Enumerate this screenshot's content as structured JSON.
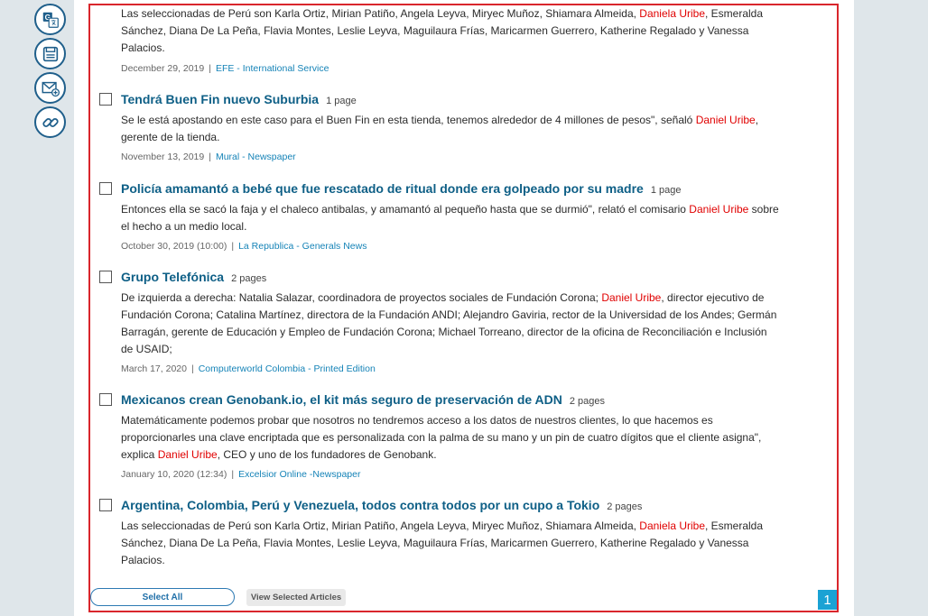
{
  "toolbar": {
    "buttons": [
      {
        "name": "translate-icon"
      },
      {
        "name": "save-icon"
      },
      {
        "name": "email-icon"
      },
      {
        "name": "link-icon"
      }
    ]
  },
  "partial_article": {
    "snippet_before": "Las seleccionadas de Perú son Karla Ortiz, Mirian Patiño, Angela Leyva, Miryec Muñoz, Shiamara Almeida, ",
    "highlight": "Daniela Uribe",
    "snippet_after": ", Esmeralda Sánchez, Diana De La Peña, Flavia Montes, Leslie Leyva, Maguilaura Frías, Maricarmen Guerrero, Katherine Regalado y Vanessa Palacios.",
    "date": "December 29, 2019",
    "separator": "|",
    "source": "EFE - International Service"
  },
  "articles": [
    {
      "title": "Tendrá Buen Fin nuevo Suburbia",
      "pages": "1 page",
      "snippet_before": "Se le está apostando en este caso para el Buen Fin en esta tienda, tenemos alrededor de 4 millones de pesos\", señaló ",
      "highlight": "Daniel Uribe",
      "snippet_after": ", gerente de la tienda.",
      "date": "November 13, 2019",
      "separator": "|",
      "source": "Mural - Newspaper"
    },
    {
      "title": "Policía amamantó a bebé que fue rescatado de ritual donde era golpeado por su madre",
      "pages": "1 page",
      "snippet_before": "Entonces ella se sacó la faja y el chaleco antibalas, y amamantó al pequeño hasta que se durmió\", relató el comisario ",
      "highlight": "Daniel Uribe",
      "snippet_after": " sobre el hecho a un medio local.",
      "date": "October 30, 2019 (10:00)",
      "separator": "|",
      "source": "La Republica - Generals News"
    },
    {
      "title": "Grupo Telefónica",
      "pages": "2 pages",
      "snippet_before": "De izquierda a derecha: Natalia Salazar, coordinadora de proyectos sociales de Fundación Corona; ",
      "highlight": "Daniel Uribe",
      "snippet_after": ", director ejecutivo de Fundación Corona; Catalina Martínez, directora de la Fundación ANDI; Alejandro Gaviria, rector de la Universidad de los Andes; Germán Barragán, gerente de Educación y Empleo de Fundación Corona; Michael Torreano, director de la oficina de Reconciliación e Inclusión de USAID;",
      "date": "March 17, 2020",
      "separator": "|",
      "source": "Computerworld Colombia - Printed Edition"
    },
    {
      "title": "Mexicanos crean Genobank.io, el kit más seguro de preservación de ADN",
      "pages": "2 pages",
      "snippet_before": "Matemáticamente podemos probar que nosotros no tendremos acceso a los datos de nuestros clientes, lo que hacemos es proporcionarles una clave encriptada que es personalizada con la palma de su mano y un pin de cuatro dígitos que el cliente asigna\", explica ",
      "highlight": "Daniel Uribe",
      "snippet_after": ", CEO y uno de los fundadores de Genobank.",
      "date": "January 10, 2020 (12:34)",
      "separator": "|",
      "source": "Excelsior Online -Newspaper"
    },
    {
      "title": "Argentina, Colombia, Perú y Venezuela, todos contra todos por un cupo a Tokio",
      "pages": "2 pages",
      "snippet_before": "Las seleccionadas de Perú son Karla Ortiz, Mirian Patiño, Angela Leyva, Miryec Muñoz, Shiamara Almeida, ",
      "highlight": "Daniela Uribe",
      "snippet_after": ", Esmeralda Sánchez, Diana De La Peña, Flavia Montes, Leslie Leyva, Maguilaura Frías, Maricarmen Guerrero, Katherine Regalado y Vanessa Palacios.",
      "date": "",
      "separator": "",
      "source": ""
    }
  ],
  "footer": {
    "select_all_label": "Select All",
    "view_selected_label": "View Selected Articles",
    "page_number": "1"
  },
  "colors": {
    "accent_border": "#d9262c",
    "title": "#0e5f86",
    "highlight": "#e00000",
    "source_link": "#1583b7",
    "page_badge": "#1aa2d4"
  }
}
